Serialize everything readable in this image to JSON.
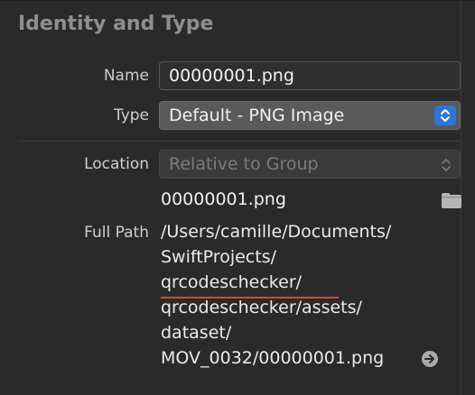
{
  "section": {
    "title": "Identity and Type"
  },
  "labels": {
    "name": "Name",
    "type": "Type",
    "location": "Location",
    "full_path": "Full Path"
  },
  "fields": {
    "name_value": "00000001.png",
    "type_value": "Default - PNG Image",
    "location_value": "Relative to Group"
  },
  "file": {
    "display_name": "00000001.png"
  },
  "full_path_lines": [
    "/Users/camille/Documents/",
    "SwiftProjects/",
    "qrcodeschecker/",
    "qrcodeschecker/assets/",
    "dataset/",
    "MOV_0032/00000001.png"
  ],
  "icons": {
    "type_select": "chevron-updown-icon",
    "location_select": "chevron-updown-icon",
    "folder": "folder-icon",
    "reveal": "arrow-right-circle-icon"
  },
  "colors": {
    "accent": "#2b76d9",
    "annotation_underline": "#e0442f"
  }
}
